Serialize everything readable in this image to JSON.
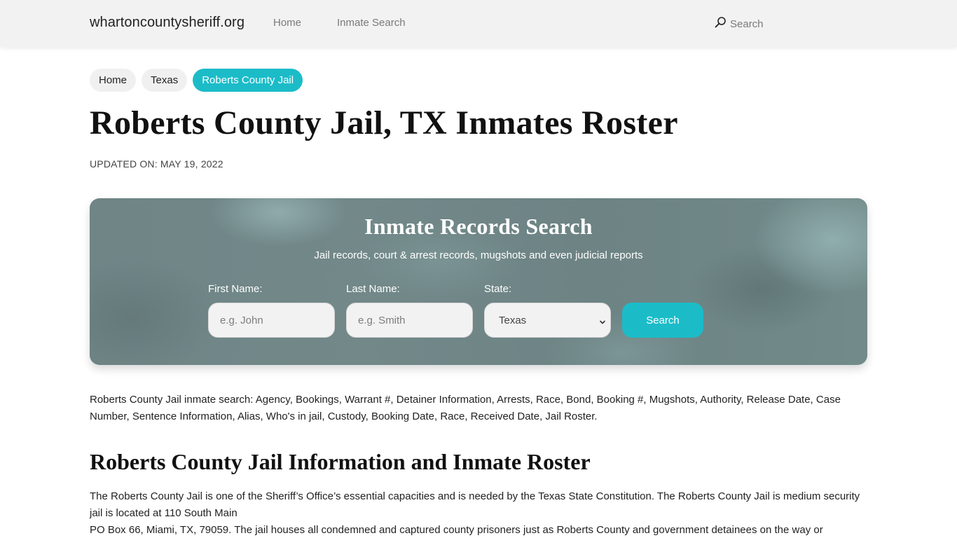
{
  "header": {
    "brand": "whartoncountysheriff.org",
    "nav": [
      {
        "label": "Home"
      },
      {
        "label": "Inmate Search"
      }
    ],
    "search": {
      "icon": "search-icon",
      "label": "Search"
    }
  },
  "breadcrumb": [
    {
      "label": "Home",
      "active": false
    },
    {
      "label": "Texas",
      "active": false
    },
    {
      "label": "Roberts County Jail",
      "active": true
    }
  ],
  "page": {
    "title": "Roberts County Jail, TX Inmates Roster",
    "updated": "UPDATED ON: MAY 19, 2022"
  },
  "search_panel": {
    "title": "Inmate Records Search",
    "subtitle": "Jail records, court & arrest records, mugshots and even judicial reports",
    "first_name": {
      "label": "First Name:",
      "placeholder": "e.g. John",
      "value": ""
    },
    "last_name": {
      "label": "Last Name:",
      "placeholder": "e.g. Smith",
      "value": ""
    },
    "state": {
      "label": "State:",
      "selected": "Texas"
    },
    "button_label": "Search"
  },
  "content": {
    "keywords_paragraph": "Roberts County Jail inmate search: Agency, Bookings, Warrant #, Detainer Information, Arrests, Race, Bond, Booking #, Mugshots, Authority, Release Date, Case Number, Sentence Information, Alias, Who's in jail, Custody, Booking Date, Race, Received Date, Jail Roster.",
    "section_title": "Roberts County Jail Information and Inmate Roster",
    "info_lines": [
      "The Roberts County Jail is one of the Sheriff’s Office’s essential capacities and is needed by the Texas State Constitution. The Roberts County Jail is medium security jail is located at 110 South Main",
      "PO Box 66, Miami, TX, 79059. The jail houses all condemned and captured county prisoners just as Roberts County and government detainees on the way or"
    ]
  },
  "colors": {
    "accent": "#1bbcc8",
    "header_bg": "#f2f2f2",
    "panel_bg": "#6f8586"
  }
}
